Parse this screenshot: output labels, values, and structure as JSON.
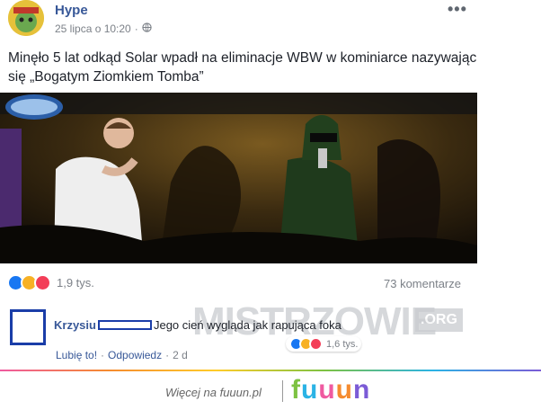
{
  "post": {
    "author": "Hype",
    "timestamp": "25 lipca o 10:20",
    "privacy_icon": "globe-icon",
    "more_icon": "ellipsis-icon",
    "text": "Minęło 5 lat odkąd Solar wpadł na eliminacje WBW w kominiarce nazywając się „Bogatym Ziomkiem Tomba”",
    "reaction_count": "1,9 tys.",
    "comments_count": "73 komentarze",
    "reactions": [
      "like",
      "haha",
      "love"
    ]
  },
  "watermark": {
    "text": "MISTRZOWIE",
    "suffix": ".ORG"
  },
  "comment": {
    "author": "Krzysiu",
    "text": "Jego cień wygląda jak rapująca foka",
    "reaction_count": "1,6 tys.",
    "like_label": "Lubię to!",
    "reply_label": "Odpowiedz",
    "separator": "·",
    "time": "2 d"
  },
  "footer": {
    "text": "Więcej na fuuun.pl",
    "logo_letters": [
      "f",
      "u",
      "u",
      "u",
      "n"
    ]
  },
  "colors": {
    "link": "#385898",
    "like": "#1877f2",
    "haha": "#f7b125",
    "love": "#f33e58",
    "redaction": "#1a3da8"
  }
}
